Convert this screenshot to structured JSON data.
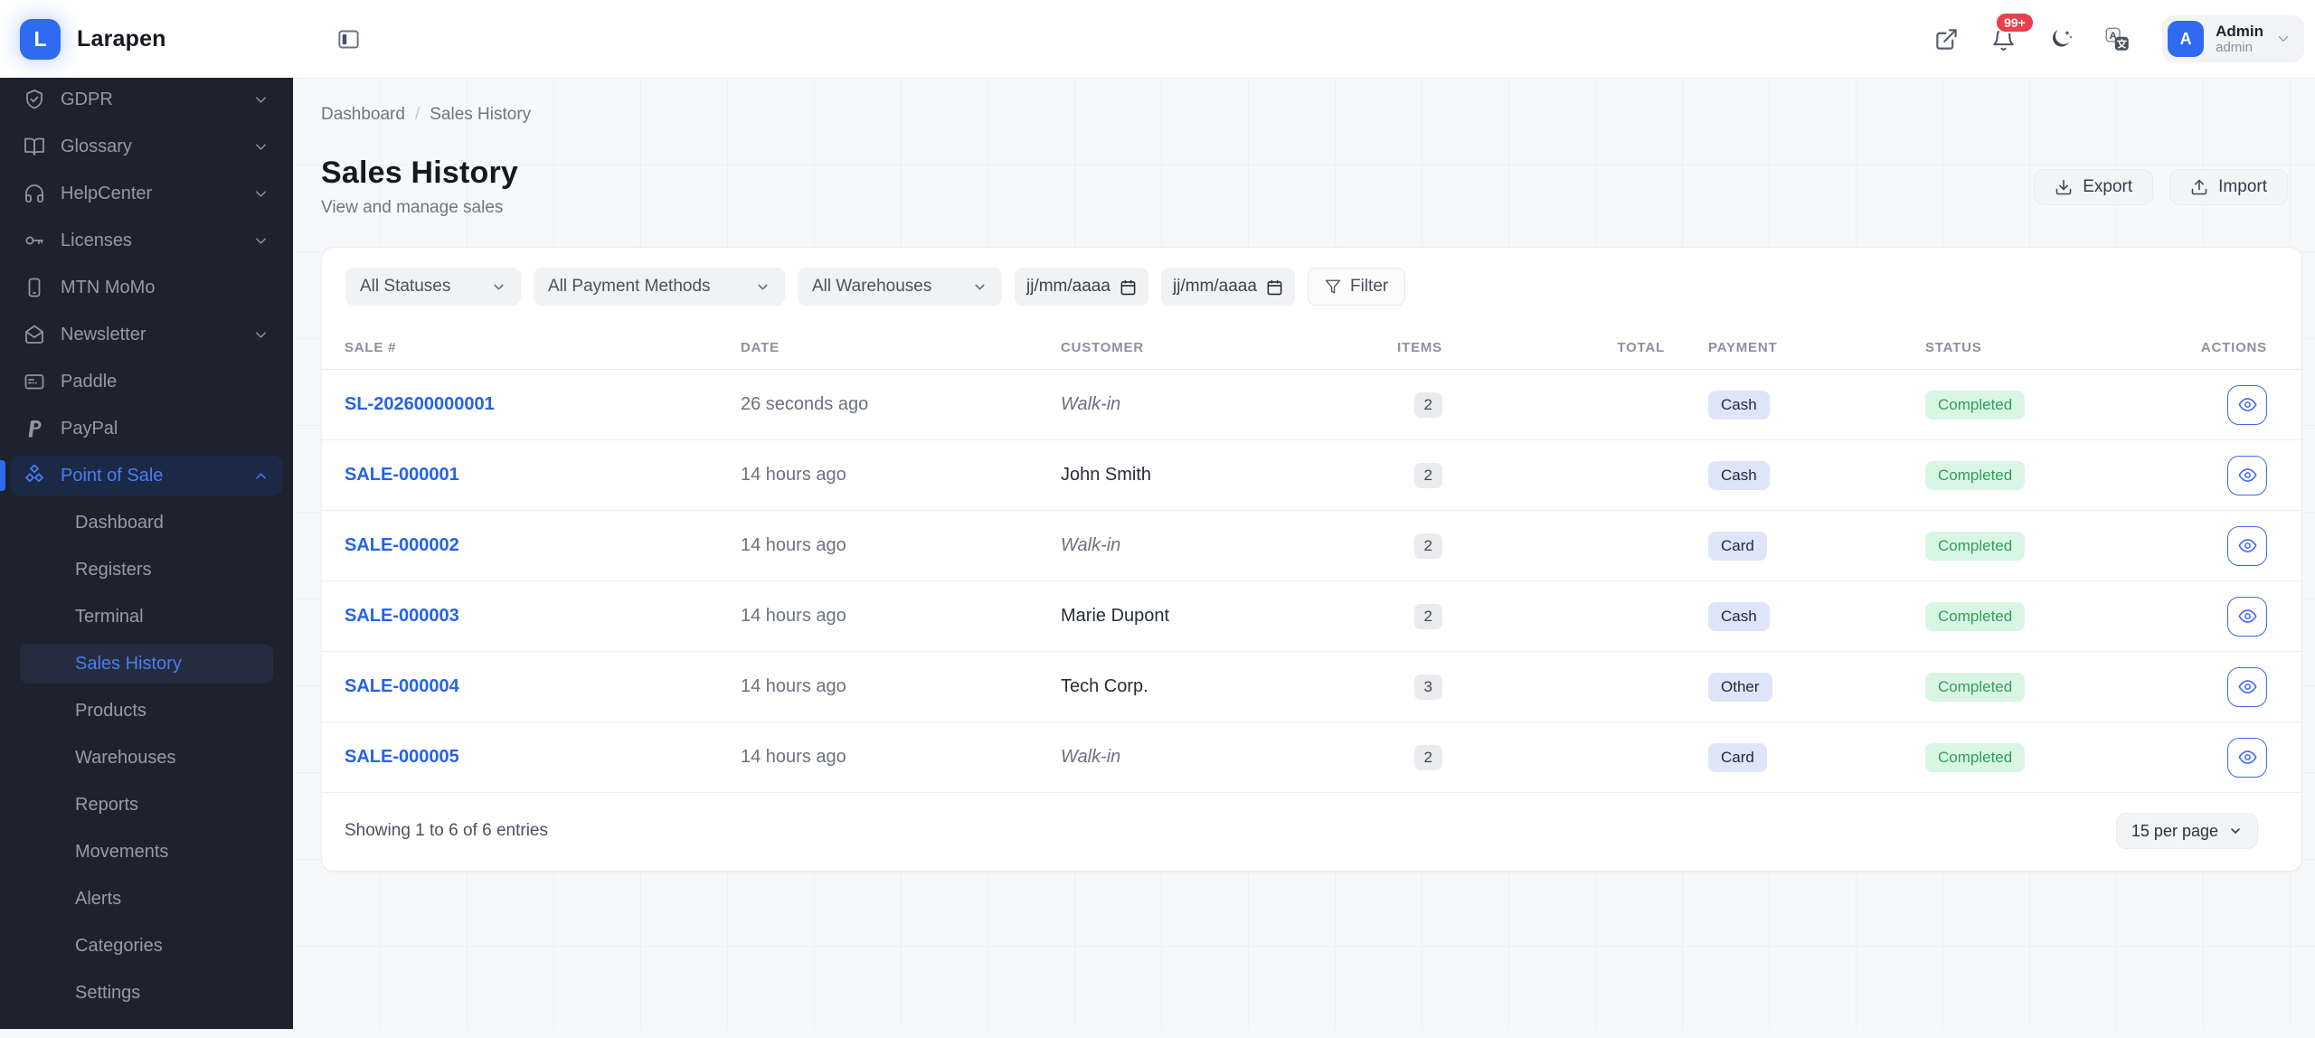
{
  "brand": {
    "logo_letter": "L",
    "name": "Larapen"
  },
  "topbar": {
    "notification_badge": "99+",
    "user": {
      "avatar_letter": "A",
      "name": "Admin",
      "role": "admin"
    }
  },
  "sidebar": {
    "items": [
      {
        "label": "GDPR",
        "icon": "shield-check",
        "chevron": "down"
      },
      {
        "label": "Glossary",
        "icon": "book-open",
        "chevron": "down"
      },
      {
        "label": "HelpCenter",
        "icon": "headphones",
        "chevron": "down"
      },
      {
        "label": "Licenses",
        "icon": "key",
        "chevron": "down"
      },
      {
        "label": "MTN MoMo",
        "icon": "smartphone",
        "chevron": null
      },
      {
        "label": "Newsletter",
        "icon": "mail-open",
        "chevron": "down"
      },
      {
        "label": "Paddle",
        "icon": "credit-card",
        "chevron": null
      },
      {
        "label": "PayPal",
        "icon": "paypal",
        "chevron": null
      },
      {
        "label": "Point of Sale",
        "icon": "cubes",
        "chevron": "up",
        "active": true,
        "active_child_index": 3,
        "children": [
          {
            "label": "Dashboard"
          },
          {
            "label": "Registers"
          },
          {
            "label": "Terminal"
          },
          {
            "label": "Sales History"
          },
          {
            "label": "Products"
          },
          {
            "label": "Warehouses"
          },
          {
            "label": "Reports"
          },
          {
            "label": "Movements"
          },
          {
            "label": "Alerts"
          },
          {
            "label": "Categories"
          },
          {
            "label": "Settings"
          }
        ]
      }
    ]
  },
  "breadcrumb": {
    "parent": "Dashboard",
    "separator": "/",
    "current": "Sales History"
  },
  "page": {
    "title": "Sales History",
    "subtitle": "View and manage sales"
  },
  "header_actions": {
    "export_label": "Export",
    "import_label": "Import"
  },
  "filters": {
    "status": "All Statuses",
    "payment": "All Payment Methods",
    "warehouse": "All Warehouses",
    "date_from_placeholder": "jj/mm/aaaa",
    "date_to_placeholder": "jj/mm/aaaa",
    "filter_label": "Filter"
  },
  "table": {
    "columns": [
      "SALE #",
      "DATE",
      "CUSTOMER",
      "ITEMS",
      "TOTAL",
      "PAYMENT",
      "STATUS",
      "ACTIONS"
    ],
    "rows": [
      {
        "sale_no": "SL-202600000001",
        "date": "26 seconds ago",
        "customer": "Walk-in",
        "customer_italic": true,
        "items": "2",
        "total": "",
        "payment": "Cash",
        "status": "Completed"
      },
      {
        "sale_no": "SALE-000001",
        "date": "14 hours ago",
        "customer": "John Smith",
        "customer_italic": false,
        "items": "2",
        "total": "",
        "payment": "Cash",
        "status": "Completed"
      },
      {
        "sale_no": "SALE-000002",
        "date": "14 hours ago",
        "customer": "Walk-in",
        "customer_italic": true,
        "items": "2",
        "total": "",
        "payment": "Card",
        "status": "Completed"
      },
      {
        "sale_no": "SALE-000003",
        "date": "14 hours ago",
        "customer": "Marie Dupont",
        "customer_italic": false,
        "items": "2",
        "total": "",
        "payment": "Cash",
        "status": "Completed"
      },
      {
        "sale_no": "SALE-000004",
        "date": "14 hours ago",
        "customer": "Tech Corp.",
        "customer_italic": false,
        "items": "3",
        "total": "",
        "payment": "Other",
        "status": "Completed"
      },
      {
        "sale_no": "SALE-000005",
        "date": "14 hours ago",
        "customer": "Walk-in",
        "customer_italic": true,
        "items": "2",
        "total": "",
        "payment": "Card",
        "status": "Completed"
      }
    ]
  },
  "footer": {
    "summary": "Showing 1 to 6 of 6 entries",
    "page_size": "15 per page"
  },
  "colors": {
    "accent_blue": "#2f6bf0",
    "link_blue": "#2563eb",
    "sidebar_bg": "#1d222e",
    "sidebar_active_bg": "#1c2946",
    "sidebar_active_text": "#4b7cf7",
    "payment_badge_bg": "#dfe5f9",
    "status_completed_bg": "#d9f6e5",
    "status_completed_text": "#2f9e5b",
    "items_badge_bg": "#e9ebee",
    "notification_red": "#e8414d",
    "grid_bg": "#f7f8f9"
  }
}
